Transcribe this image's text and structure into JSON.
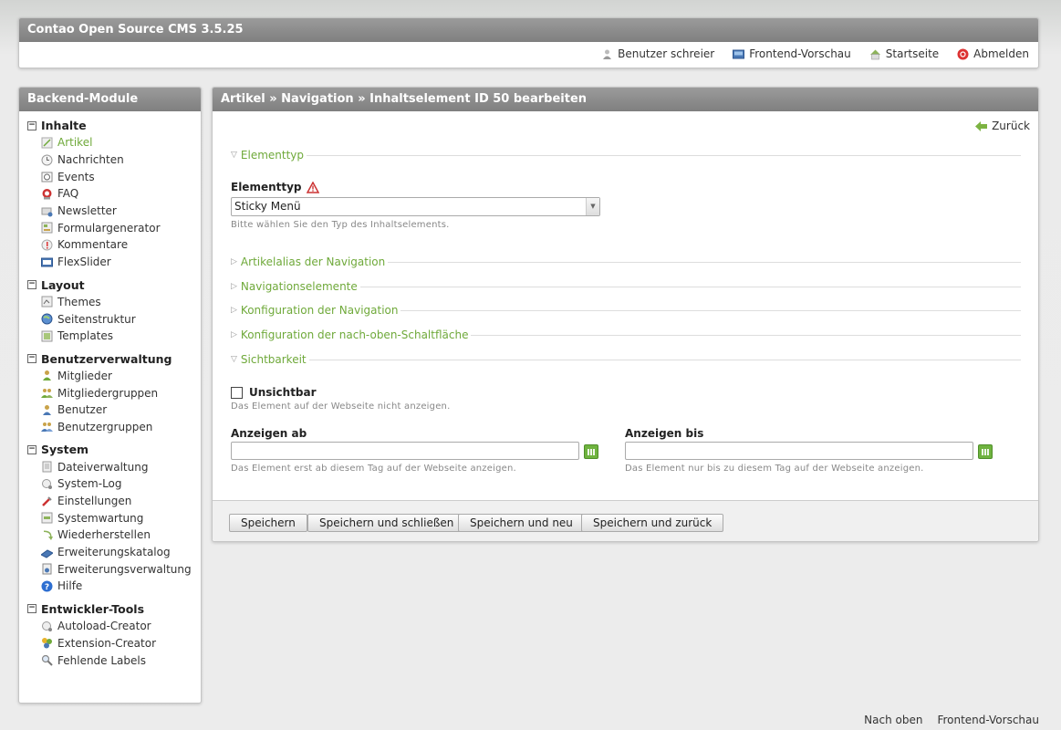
{
  "header": {
    "title": "Contao Open Source CMS 3.5.25",
    "links": [
      {
        "label": "Benutzer schreier",
        "icon": "user-icon"
      },
      {
        "label": "Frontend-Vorschau",
        "icon": "preview-icon"
      },
      {
        "label": "Startseite",
        "icon": "home-icon"
      },
      {
        "label": "Abmelden",
        "icon": "logout-icon"
      }
    ]
  },
  "sidebar": {
    "title": "Backend-Module",
    "groups": [
      {
        "label": "Inhalte",
        "items": [
          "Artikel",
          "Nachrichten",
          "Events",
          "FAQ",
          "Newsletter",
          "Formulargenerator",
          "Kommentare",
          "FlexSlider"
        ]
      },
      {
        "label": "Layout",
        "items": [
          "Themes",
          "Seitenstruktur",
          "Templates"
        ]
      },
      {
        "label": "Benutzerverwaltung",
        "items": [
          "Mitglieder",
          "Mitgliedergruppen",
          "Benutzer",
          "Benutzergruppen"
        ]
      },
      {
        "label": "System",
        "items": [
          "Dateiverwaltung",
          "System-Log",
          "Einstellungen",
          "Systemwartung",
          "Wiederherstellen",
          "Erweiterungskatalog",
          "Erweiterungsverwaltung",
          "Hilfe"
        ]
      },
      {
        "label": "Entwickler-Tools",
        "items": [
          "Autoload-Creator",
          "Extension-Creator",
          "Fehlende Labels"
        ]
      }
    ]
  },
  "main": {
    "title": "Artikel » Navigation » Inhaltselement ID 50 bearbeiten",
    "back_label": "Zurück",
    "legends": {
      "elementtyp": "Elementtyp",
      "artikelalias": "Artikelalias der Navigation",
      "navigationselemente": "Navigationselemente",
      "konfiguration": "Konfiguration der Navigation",
      "nachoben": "Konfiguration der nach-oben-Schaltfläche",
      "sichtbarkeit": "Sichtbarkeit"
    },
    "elementtyp": {
      "label": "Elementtyp",
      "value": "Sticky Menü",
      "hint": "Bitte wählen Sie den Typ des Inhaltselements."
    },
    "unsichtbar": {
      "label": "Unsichtbar",
      "hint": "Das Element auf der Webseite nicht anzeigen."
    },
    "anzeigen_ab": {
      "label": "Anzeigen ab",
      "value": "",
      "hint": "Das Element erst ab diesem Tag auf der Webseite anzeigen."
    },
    "anzeigen_bis": {
      "label": "Anzeigen bis",
      "value": "",
      "hint": "Das Element nur bis zu diesem Tag auf der Webseite anzeigen."
    },
    "buttons": {
      "save": "Speichern",
      "save_close": "Speichern und schließen",
      "save_new": "Speichern und neu",
      "save_back": "Speichern und zurück"
    }
  },
  "footer": {
    "top": "Nach oben",
    "preview": "Frontend-Vorschau"
  },
  "colors": {
    "accent_green": "#6fa93a",
    "header_gray": "#8c8c8c"
  }
}
